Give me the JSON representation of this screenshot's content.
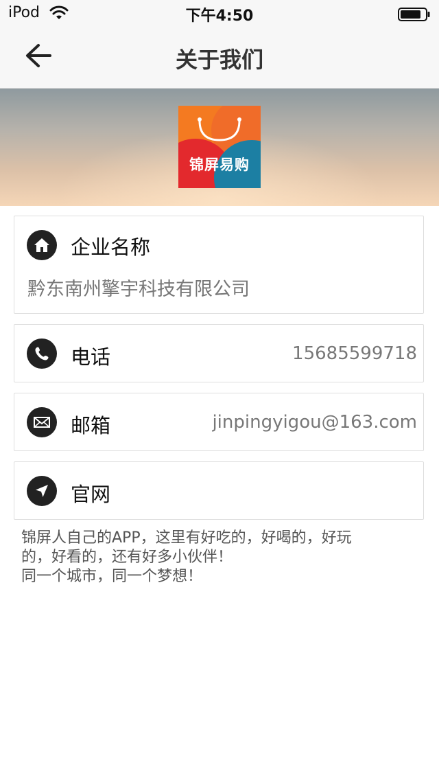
{
  "status_bar": {
    "carrier": "iPod",
    "time": "下午4:50"
  },
  "nav": {
    "title": "关于我们",
    "back_icon": "arrow-left-icon"
  },
  "banner": {
    "logo_text": "锦屏易购"
  },
  "company": {
    "label": "企业名称",
    "value": "黔东南州擎宇科技有限公司",
    "icon": "home-icon"
  },
  "phone": {
    "label": "电话",
    "value": "15685599718",
    "icon": "phone-icon"
  },
  "email": {
    "label": "邮箱",
    "value": "jinpingyigou@163.com",
    "icon": "mail-icon"
  },
  "website": {
    "label": "官网",
    "icon": "location-arrow-icon"
  },
  "description": "锦屏人自己的APP，这里有好吃的，好喝的，好玩\n的，好看的，还有好多小伙伴！\n同一个城市，同一个梦想！",
  "colors": {
    "icon_circle": "#222222",
    "value_text": "#777777",
    "logo_red": "#e3292d",
    "logo_blue": "#1c7fa3",
    "logo_orange": "#f47a21"
  }
}
